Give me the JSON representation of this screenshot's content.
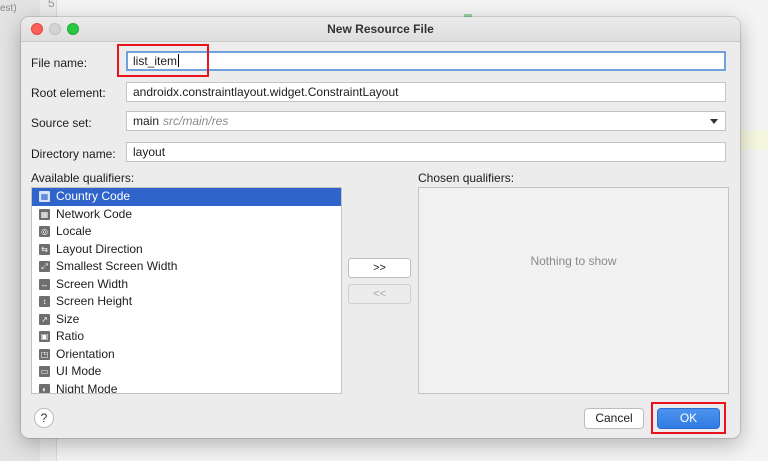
{
  "background": {
    "line_number": "5",
    "snippet": "est)"
  },
  "dialog": {
    "title": "New Resource File",
    "window_buttons": [
      "close",
      "minimize",
      "maximize"
    ]
  },
  "form": {
    "file_name": {
      "label": "File name:",
      "value": "list_item"
    },
    "root_element": {
      "label": "Root element:",
      "value": "androidx.constraintlayout.widget.ConstraintLayout"
    },
    "source_set": {
      "label": "Source set:",
      "value": "main",
      "hint": "src/main/res"
    },
    "directory_name": {
      "label": "Directory name:",
      "value": "layout"
    }
  },
  "qualifiers": {
    "available_label": "Available qualifiers:",
    "chosen_label": "Chosen qualifiers:",
    "available": [
      {
        "label": "Country Code",
        "icon": "country-code-icon",
        "glyph": "▦",
        "selected": true
      },
      {
        "label": "Network Code",
        "icon": "network-code-icon",
        "glyph": "▦",
        "selected": false
      },
      {
        "label": "Locale",
        "icon": "globe-icon",
        "glyph": "◎",
        "selected": false
      },
      {
        "label": "Layout Direction",
        "icon": "layout-direction-icon",
        "glyph": "⇆",
        "selected": false
      },
      {
        "label": "Smallest Screen Width",
        "icon": "smallest-screen-width-icon",
        "glyph": "⤢",
        "selected": false
      },
      {
        "label": "Screen Width",
        "icon": "screen-width-icon",
        "glyph": "↔",
        "selected": false
      },
      {
        "label": "Screen Height",
        "icon": "screen-height-icon",
        "glyph": "↕",
        "selected": false
      },
      {
        "label": "Size",
        "icon": "size-icon",
        "glyph": "↗",
        "selected": false
      },
      {
        "label": "Ratio",
        "icon": "ratio-icon",
        "glyph": "▣",
        "selected": false
      },
      {
        "label": "Orientation",
        "icon": "orientation-icon",
        "glyph": "◳",
        "selected": false
      },
      {
        "label": "UI Mode",
        "icon": "ui-mode-icon",
        "glyph": "▭",
        "selected": false
      },
      {
        "label": "Night Mode",
        "icon": "night-mode-icon",
        "glyph": "◐",
        "selected": false
      }
    ],
    "add_button": ">>",
    "remove_button": "<<",
    "chosen_empty": "Nothing to show"
  },
  "footer": {
    "help_label": "?",
    "cancel_label": "Cancel",
    "ok_label": "OK"
  },
  "colors": {
    "selection": "#2f65ca",
    "ok_button": "#2f7ae4",
    "highlight_box": "#e8131c"
  }
}
